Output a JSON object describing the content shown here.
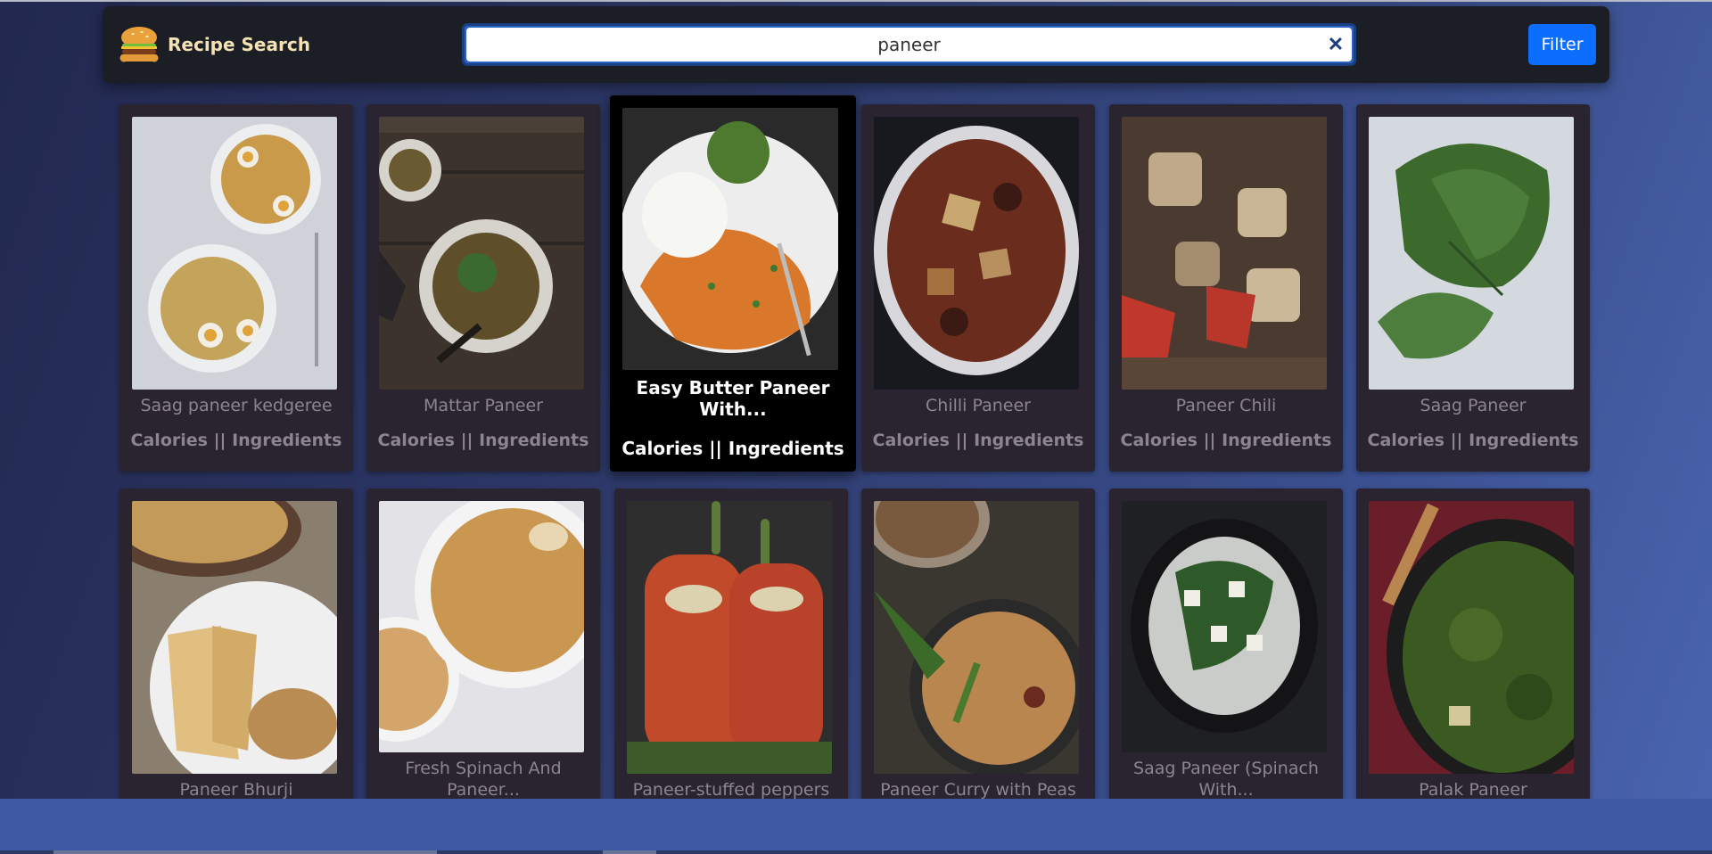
{
  "brand": {
    "title": "Recipe Search",
    "logo_icon": "burger-icon"
  },
  "search": {
    "value": "paneer",
    "clear_label": "✕",
    "clear_icon": "close-icon"
  },
  "filter": {
    "label": "Filter"
  },
  "cards": [
    {
      "title": "Saag paneer kedgeree",
      "meta": "Calories || Ingredients",
      "palette": [
        "#dfe2e6",
        "#c59b46",
        "#a5342a"
      ]
    },
    {
      "title": "Mattar Paneer",
      "meta": "Calories || Ingredients",
      "palette": [
        "#4a4036",
        "#8a6b3d",
        "#2f5a2e"
      ]
    },
    {
      "title": "Easy Butter Paneer With...",
      "meta": "Calories || Ingredients",
      "palette": [
        "#e8e2d6",
        "#d87a2a",
        "#3e7a2f"
      ]
    },
    {
      "title": "Chilli Paneer",
      "meta": "Calories || Ingredients",
      "palette": [
        "#1a1c22",
        "#7a2e1c",
        "#c09256"
      ]
    },
    {
      "title": "Paneer Chili",
      "meta": "Calories || Ingredients",
      "palette": [
        "#5a4a3e",
        "#c7b08a",
        "#b5362b"
      ]
    },
    {
      "title": "Saag Paneer",
      "meta": "Calories || Ingredients",
      "palette": [
        "#d8dde2",
        "#3c6a2d",
        "#57844a"
      ]
    },
    {
      "title": "Paneer Bhurji",
      "meta": "",
      "palette": [
        "#d3d3d6",
        "#cfa05b",
        "#6a7b3a"
      ]
    },
    {
      "title": "Fresh Spinach And Paneer...",
      "meta": "",
      "palette": [
        "#e3e2e6",
        "#c59b5c",
        "#a97a3e"
      ]
    },
    {
      "title": "Paneer-stuffed peppers",
      "meta": "",
      "palette": [
        "#2a2a2a",
        "#c04a2a",
        "#5e7a3a"
      ]
    },
    {
      "title": "Paneer Curry with Peas",
      "meta": "",
      "palette": [
        "#3a3630",
        "#c79a5a",
        "#4a6a2e"
      ]
    },
    {
      "title": "Saag Paneer (Spinach With...",
      "meta": "",
      "palette": [
        "#1c1d20",
        "#e2e6e8",
        "#2e5a2a"
      ]
    },
    {
      "title": "Palak Paneer",
      "meta": "",
      "palette": [
        "#6a1e2a",
        "#3c5422",
        "#1c1c1c"
      ]
    }
  ]
}
